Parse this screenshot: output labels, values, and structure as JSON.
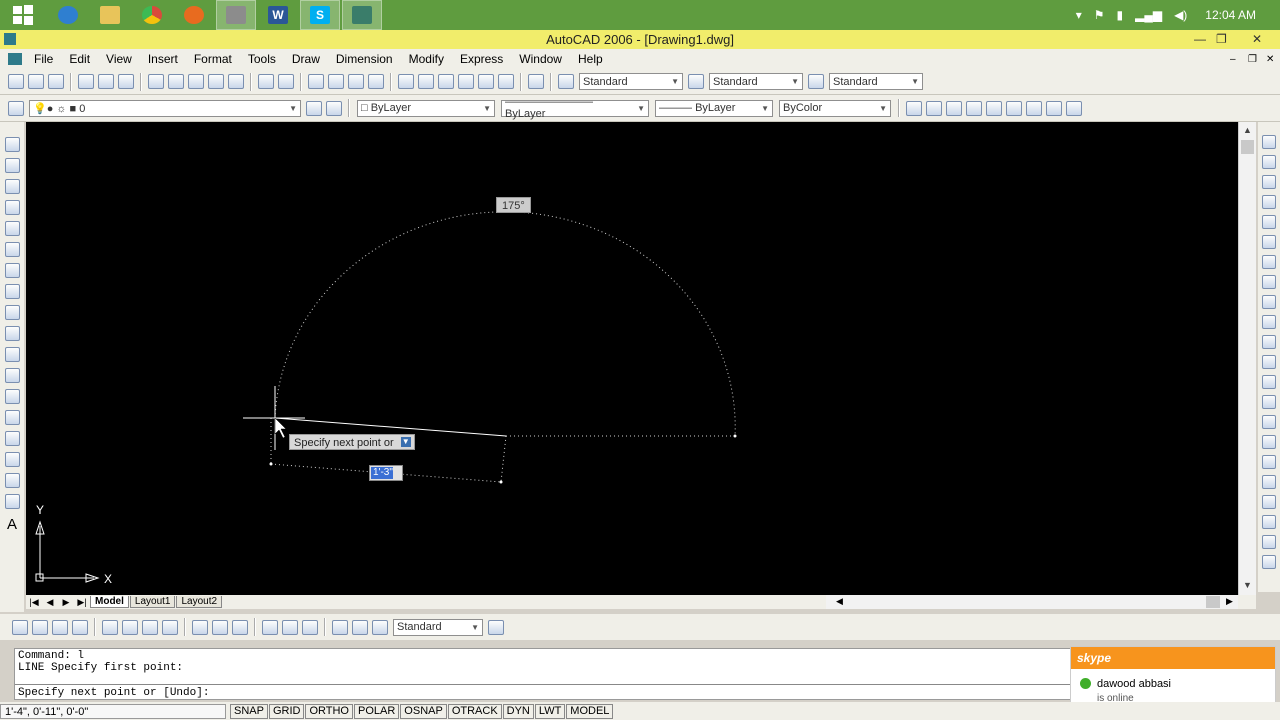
{
  "taskbar": {
    "apps": [
      {
        "icon": "ie-icon",
        "color": "#2f7fd0"
      },
      {
        "icon": "folder-icon",
        "color": "#e8c45a"
      },
      {
        "icon": "chrome-icon",
        "color": "#d94a3b"
      },
      {
        "icon": "firefox-icon",
        "color": "#e86b1f"
      },
      {
        "icon": "tool-icon",
        "color": "#9a9a9a"
      },
      {
        "icon": "word-icon",
        "color": "#2b5797"
      },
      {
        "icon": "skype-icon",
        "color": "#00aff0"
      },
      {
        "icon": "autocad-icon",
        "color": "#3a7d6a"
      }
    ],
    "time": "12:04 AM"
  },
  "window": {
    "title": "AutoCAD 2006 - [Drawing1.dwg]"
  },
  "menu": [
    "File",
    "Edit",
    "View",
    "Insert",
    "Format",
    "Tools",
    "Draw",
    "Dimension",
    "Modify",
    "Express",
    "Window",
    "Help"
  ],
  "toolbar": {
    "text_style": "Standard",
    "dim_style": "Standard",
    "table_style": "Standard",
    "layer": "0",
    "color": "ByLayer",
    "linetype": "ByLayer",
    "lineweight": "ByLayer",
    "plotstyle": "ByColor"
  },
  "drawing": {
    "angle_tooltip": "175°",
    "prompt_tooltip": "Specify next point or",
    "length_input": "1'-3\"",
    "ucs_x": "X",
    "ucs_y": "Y"
  },
  "layout_tabs": [
    "Model",
    "Layout1",
    "Layout2"
  ],
  "dim_toolbar": {
    "style": "Standard"
  },
  "command": {
    "line1": "Command: l",
    "line2": "LINE Specify first point:",
    "line3": "Specify next point or [Undo]:"
  },
  "status": {
    "coords": "1'-4\",  0'-11\",  0'-0\"",
    "modes": [
      "SNAP",
      "GRID",
      "ORTHO",
      "POLAR",
      "OSNAP",
      "OTRACK",
      "DYN",
      "LWT",
      "MODEL"
    ]
  },
  "skype": {
    "brand": "skype",
    "contact": "dawood abbasi",
    "status": "is online"
  }
}
